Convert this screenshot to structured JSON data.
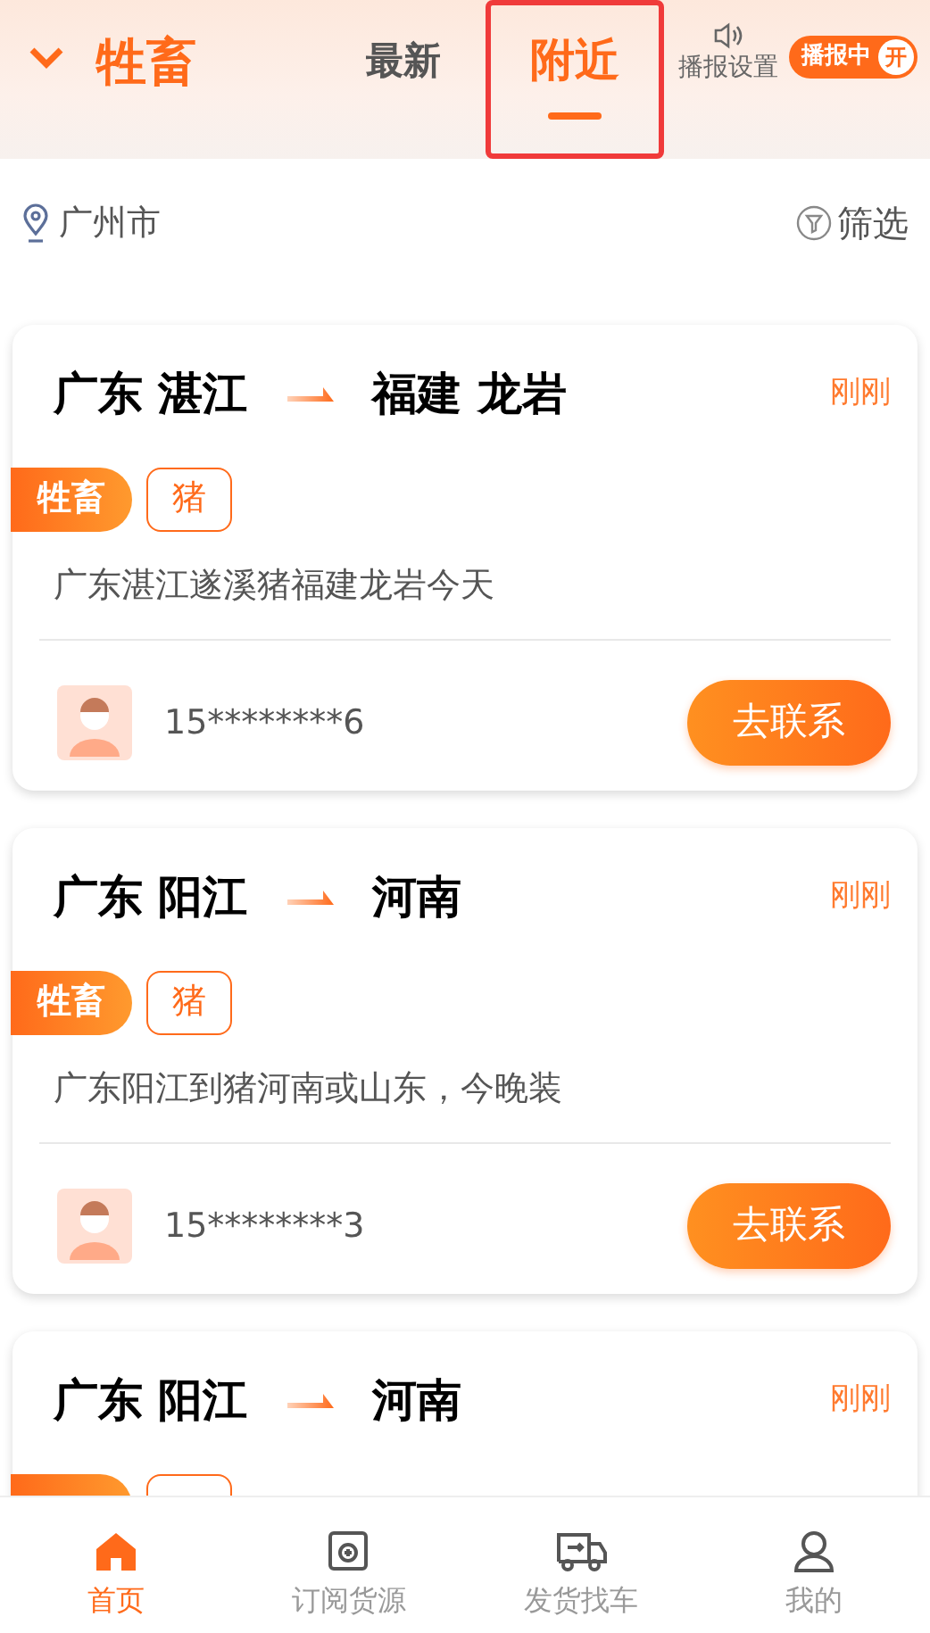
{
  "header": {
    "title": "牲畜",
    "tabs": [
      {
        "label": "最新",
        "selected": false,
        "highlighted": false
      },
      {
        "label": "附近",
        "selected": true,
        "highlighted": true
      }
    ],
    "broadcast_settings": "播报设置",
    "broadcast_badge": {
      "label": "播报中",
      "toggle": "开",
      "on": true
    }
  },
  "location": "广州市",
  "filter": "筛选",
  "cards": [
    {
      "from": "广东 湛江",
      "to": "福建 龙岩",
      "time": "刚刚",
      "tags": [
        {
          "kind": "category",
          "label": "牲畜"
        },
        {
          "kind": "item",
          "label": "猪"
        }
      ],
      "description": "广东湛江遂溪猪福建龙岩今天",
      "phone": "15********6",
      "action": "去联系"
    },
    {
      "from": "广东 阳江",
      "to": "河南",
      "time": "刚刚",
      "tags": [
        {
          "kind": "category",
          "label": "牲畜"
        },
        {
          "kind": "item",
          "label": "猪"
        }
      ],
      "description": "广东阳江到猪河南或山东，今晚装",
      "phone": "15********3",
      "action": "去联系"
    },
    {
      "from": "广东 阳江",
      "to": "河南",
      "time": "刚刚",
      "tags": [
        {
          "kind": "category"
        },
        {
          "kind": "item"
        }
      ]
    }
  ],
  "nav": [
    {
      "label": "首页",
      "selected": true,
      "kind": "home"
    },
    {
      "label": "订阅货源",
      "selected": false,
      "kind": "subscribe"
    },
    {
      "label": "发货找车",
      "selected": false,
      "kind": "truck"
    },
    {
      "label": "我的",
      "selected": false,
      "kind": "user"
    }
  ]
}
